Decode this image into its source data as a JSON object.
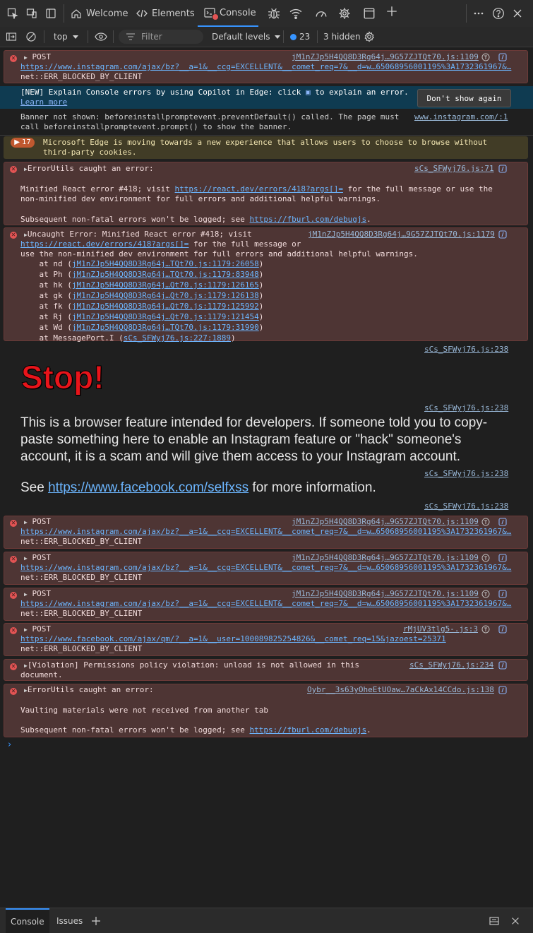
{
  "tabs": {
    "welcome": "Welcome",
    "elements": "Elements",
    "console": "Console"
  },
  "toolbar": {
    "context": "top",
    "filter_placeholder": "Filter",
    "levels": "Default levels",
    "issues_count": "23",
    "hidden": "3 hidden"
  },
  "messages": {
    "post1": {
      "method": "POST",
      "source": "jM1nZJp5H4QQ8D3Rg64j…9G57ZJTQt70.js:1109",
      "url": "https://www.instagram.com/ajax/bz?__a=1&__ccg=EXCELLENT&__comet_req=7&__d=w…65068956001195%3A1732361967&…",
      "error": "net::ERR_BLOCKED_BY_CLIENT"
    },
    "copilot": {
      "text": "[NEW] Explain Console errors by using Copilot in Edge: click",
      "text2": "to explain an error.",
      "learn": "Learn more",
      "button": "Don't show again"
    },
    "banner": {
      "line1": "Banner not shown: beforeinstallpromptevent.preventDefault() called. The page must",
      "line2": "call beforeinstallpromptevent.prompt() to show the banner.",
      "source": "www.instagram.com/:1"
    },
    "edge_warn": {
      "count": "17",
      "line1": "Microsoft Edge is moving towards a new experience that allows users to choose to browse without",
      "line2": "third-party cookies."
    },
    "errutils1": {
      "title": "ErrorUtils caught an error:",
      "source": "sCs_SFWyj76.js:71",
      "l1a": "Minified React error #418; visit ",
      "l1link": "https://react.dev/errors/418?args[]=",
      "l1b": " for the full message or use the",
      "l2": "non-minified dev environment for full errors and additional helpful warnings.",
      "l3a": "Subsequent non-fatal errors won't be logged; see ",
      "l3link": "https://fburl.com/debugjs",
      "l3b": "."
    },
    "uncaught": {
      "title": "Uncaught Error: Minified React error #418; visit",
      "source": "jM1nZJp5H4QQ8D3Rg64j…9G57ZJTQt70.js:1179",
      "l2link": "https://react.dev/errors/418?args[]=",
      "l2b": " for the full message or",
      "l3": "use the non-minified dev environment for full errors and additional helpful warnings.",
      "stack": [
        {
          "fn": "    at nd (",
          "loc": "jM1nZJp5H4QQ8D3Rg64j…TQt70.js:1179:26058",
          "end": ")"
        },
        {
          "fn": "    at Ph (",
          "loc": "jM1nZJp5H4QQ8D3Rg64j…TQt70.js:1179:83948",
          "end": ")"
        },
        {
          "fn": "    at hk (",
          "loc": "jM1nZJp5H4QQ8D3Rg64j…Qt70.js:1179:126165",
          "end": ")"
        },
        {
          "fn": "    at gk (",
          "loc": "jM1nZJp5H4QQ8D3Rg64j…Qt70.js:1179:126138",
          "end": ")"
        },
        {
          "fn": "    at fk (",
          "loc": "jM1nZJp5H4QQ8D3Rg64j…Qt70.js:1179:125992",
          "end": ")"
        },
        {
          "fn": "    at Rj (",
          "loc": "jM1nZJp5H4QQ8D3Rg64j…Qt70.js:1179:121454",
          "end": ")"
        },
        {
          "fn": "    at Wd (",
          "loc": "jM1nZJp5H4QQ8D3Rg64j…TQt70.js:1179:31990",
          "end": ")"
        },
        {
          "fn": "    at MessagePort.I (",
          "loc": "sCs_SFWyj76.js:227:1889",
          "end": ")"
        }
      ]
    },
    "stop": {
      "src1": "sCs_SFWyj76.js:238",
      "title": "Stop!",
      "src2": "sCs_SFWyj76.js:238",
      "body1": "This is a browser feature intended for developers. If someone told you to copy-",
      "body2": "paste something here to enable an Instagram feature or \"hack\" someone's",
      "body3": "account, it is a scam and will give them access to your Instagram account.",
      "src3": "sCs_SFWyj76.js:238",
      "see": "See ",
      "see_link": "https://www.facebook.com/selfxss",
      "see_end": " for more information.",
      "src4": "sCs_SFWyj76.js:238"
    },
    "post2": {
      "method": "POST",
      "source": "jM1nZJp5H4QQ8D3Rg64j…9G57ZJTQt70.js:1109",
      "url": "https://www.instagram.com/ajax/bz?__a=1&__ccg=EXCELLENT&__comet_req=7&__d=w…65068956001195%3A1732361967&…",
      "error": "net::ERR_BLOCKED_BY_CLIENT"
    },
    "post3": {
      "method": "POST",
      "source": "jM1nZJp5H4QQ8D3Rg64j…9G57ZJTQt70.js:1109",
      "url": "https://www.instagram.com/ajax/bz?__a=1&__ccg=EXCELLENT&__comet_req=7&__d=w…65068956001195%3A1732361967&…",
      "error": "net::ERR_BLOCKED_BY_CLIENT"
    },
    "post4": {
      "method": "POST",
      "source": "jM1nZJp5H4QQ8D3Rg64j…9G57ZJTQt70.js:1109",
      "url": "https://www.instagram.com/ajax/bz?__a=1&__ccg=EXCELLENT&__comet_req=7&__d=w…65068956001195%3A1732361967&…",
      "error": "net::ERR_BLOCKED_BY_CLIENT"
    },
    "post5": {
      "method": "POST",
      "source": "rMjUV3tlg5-.js:3",
      "url": "https://www.facebook.com/ajax/qm/?__a=1&__user=100089825254826&__comet_req=15&jazoest=25371",
      "error": "net::ERR_BLOCKED_BY_CLIENT"
    },
    "violation": {
      "line1": "[Violation] Permissions policy violation: unload is not allowed in this",
      "line2": "document.",
      "source": "sCs_SFWyj76.js:234"
    },
    "errutils2": {
      "title": "ErrorUtils caught an error:",
      "source": "Oybr__3s63yOheEtUOaw…7aCkAx14CCdo.js:138",
      "l1": "Vaulting materials were not received from another tab",
      "l3a": "Subsequent non-fatal errors won't be logged; see ",
      "l3link": "https://fburl.com/debugjs",
      "l3b": "."
    }
  },
  "drawer": {
    "console": "Console",
    "issues": "Issues"
  },
  "colors": {
    "accent": "#3794ff",
    "error_bg": "#4e3534",
    "warn_bg": "#413c26",
    "stop_red": "#e8141a"
  }
}
